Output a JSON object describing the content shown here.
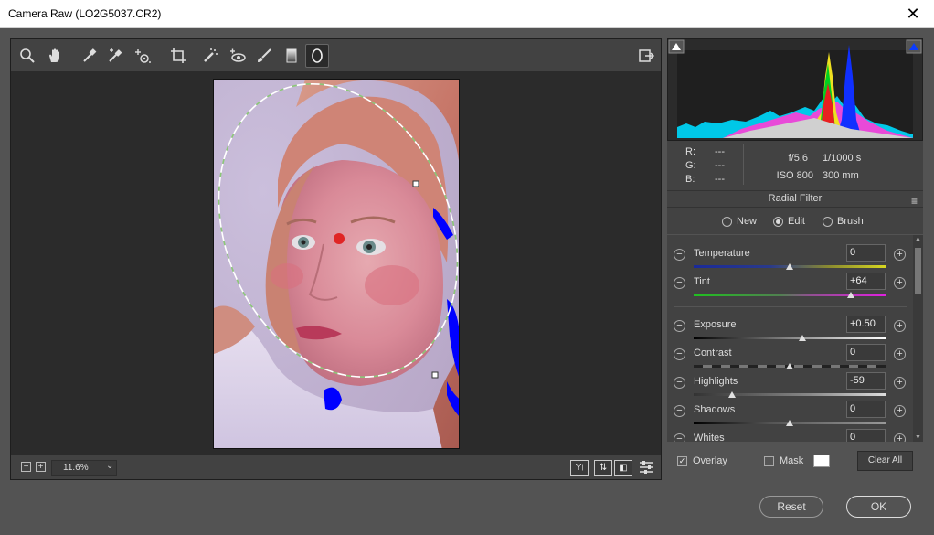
{
  "window": {
    "title": "Camera Raw (LO2G5037.CR2)",
    "close_glyph": "✕"
  },
  "toolbar": {
    "tools": [
      {
        "name": "zoom-tool-icon"
      },
      {
        "name": "hand-tool-icon"
      },
      {
        "name": "white-balance-tool-icon"
      },
      {
        "name": "color-sampler-tool-icon"
      },
      {
        "name": "targeted-adjustment-tool-icon"
      },
      {
        "name": "crop-tool-icon"
      },
      {
        "name": "spot-removal-tool-icon"
      },
      {
        "name": "red-eye-removal-tool-icon"
      },
      {
        "name": "adjustment-brush-icon"
      },
      {
        "name": "graduated-filter-icon"
      },
      {
        "name": "radial-filter-icon",
        "active": true
      }
    ]
  },
  "zoom": {
    "minus": "−",
    "plus": "+",
    "value": "11.6%",
    "dropdown": "⌄"
  },
  "info": {
    "r_label": "R:",
    "r_value": "---",
    "g_label": "G:",
    "g_value": "---",
    "b_label": "B:",
    "b_value": "---",
    "aperture": "f/5.6",
    "shutter": "1/1000 s",
    "iso": "ISO 800",
    "focal": "300 mm"
  },
  "panel": {
    "title": "Radial Filter",
    "menu_glyph": "≡",
    "modes": [
      {
        "label": "New",
        "selected": false
      },
      {
        "label": "Edit",
        "selected": true
      },
      {
        "label": "Brush",
        "selected": false
      }
    ]
  },
  "sliders": [
    {
      "label": "Temperature",
      "value": "0",
      "position": 0.5
    },
    {
      "label": "Tint",
      "value": "+64",
      "position": 0.82
    },
    {
      "label": "Exposure",
      "value": "+0.50",
      "position": 0.56
    },
    {
      "label": "Contrast",
      "value": "0",
      "position": 0.5
    },
    {
      "label": "Highlights",
      "value": "-59",
      "position": 0.2
    },
    {
      "label": "Shadows",
      "value": "0",
      "position": 0.5
    },
    {
      "label": "Whites",
      "value": "0",
      "position": 0.5
    }
  ],
  "overlay": {
    "overlay_label": "Overlay",
    "overlay_checked": true,
    "check_glyph": "✓",
    "mask_label": "Mask",
    "mask_checked": false,
    "clear_all_label": "Clear All"
  },
  "buttons": {
    "reset_label": "Reset",
    "ok_label": "OK"
  },
  "colors": {
    "panel_bg": "#424242",
    "canvas_bg": "#2b2b2b",
    "shadow_clip": "#0000ff",
    "pin": "#e02525"
  }
}
